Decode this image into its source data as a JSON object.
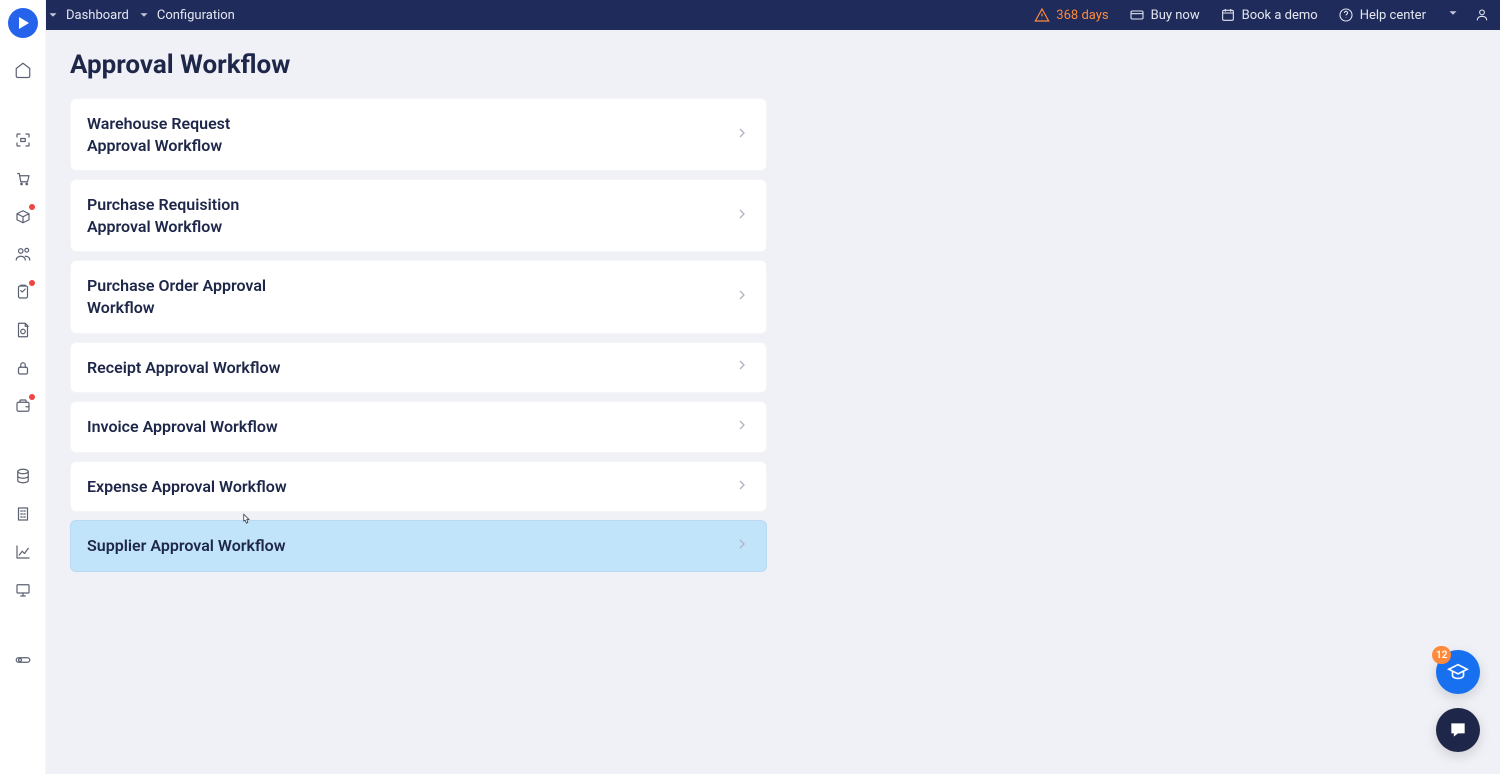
{
  "breadcrumbs": [
    {
      "label": "Dashboard"
    },
    {
      "label": "Configuration"
    }
  ],
  "header": {
    "trial_days": "368 days",
    "buy_now": "Buy now",
    "book_demo": "Book a demo",
    "help_center": "Help center"
  },
  "page_title": "Approval Workflow",
  "workflows": [
    {
      "title": "Warehouse Request Approval Workflow"
    },
    {
      "title": "Purchase Requisition Approval Workflow"
    },
    {
      "title": "Purchase Order Approval Workflow"
    },
    {
      "title": "Receipt Approval Workflow"
    },
    {
      "title": "Invoice Approval Workflow"
    },
    {
      "title": "Expense Approval Workflow"
    },
    {
      "title": "Supplier Approval Workflow"
    }
  ],
  "fab_badge": "12"
}
